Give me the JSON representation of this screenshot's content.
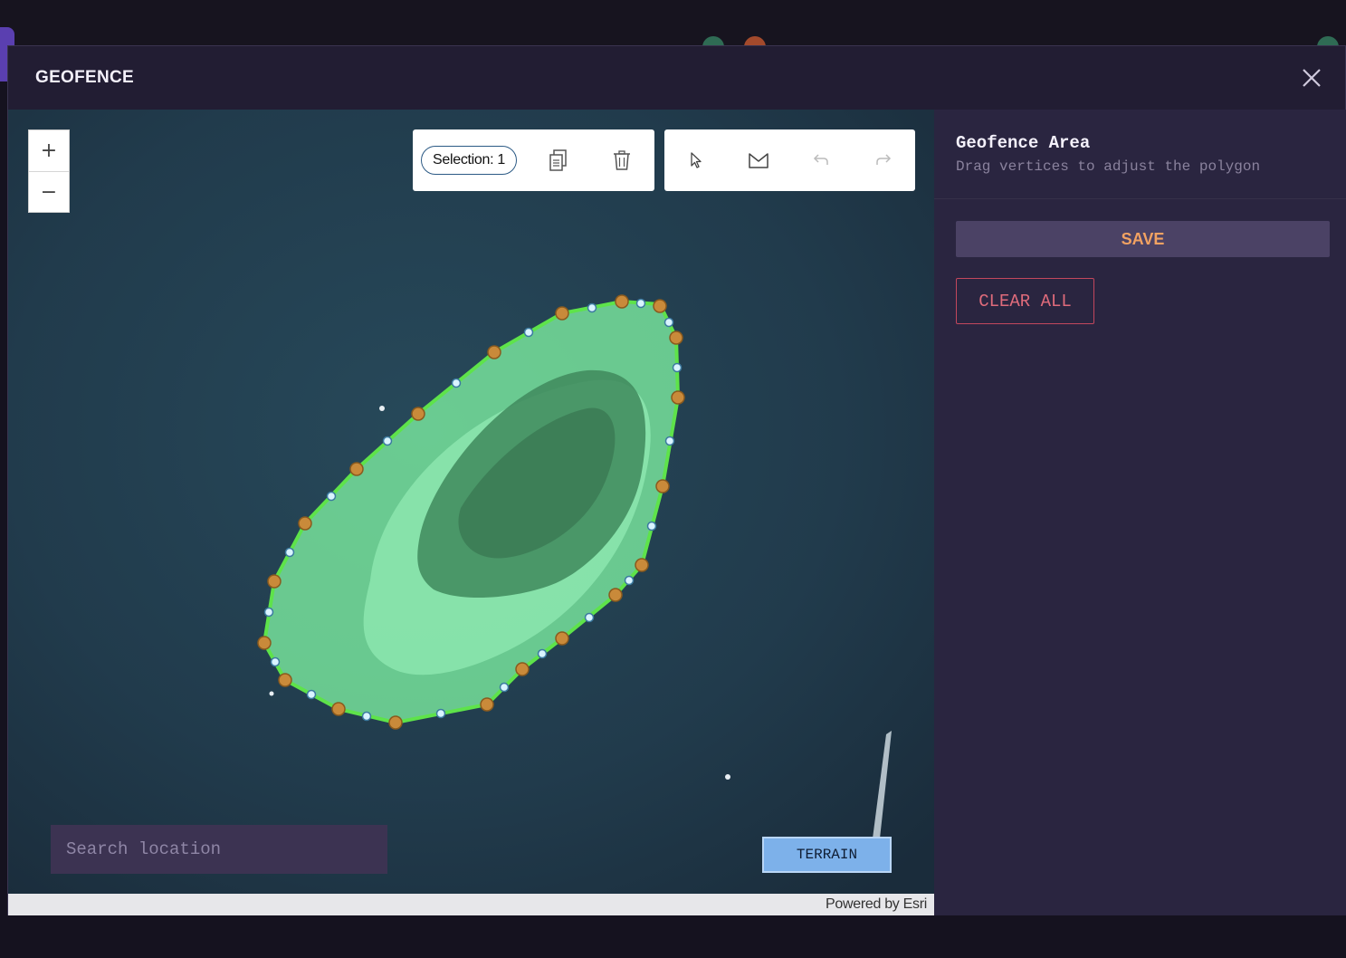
{
  "modal": {
    "title": "GEOFENCE"
  },
  "map": {
    "zoom_in_label": "+",
    "zoom_out_label": "−",
    "selection_label": "Selection: 1",
    "search_placeholder": "Search location",
    "terrain_label": "TERRAIN",
    "attribution": "Powered by Esri",
    "geofence_fill_color": "#7ef0a2",
    "geofence_stroke_color": "#5ee34a",
    "vertex_color": "#c98a3a",
    "midpoint_color": "#d9f4ff"
  },
  "panel": {
    "title": "Geofence Area",
    "subtitle": "Drag vertices to adjust the polygon",
    "save_label": "SAVE",
    "clear_label": "CLEAR ALL",
    "save_text_color": "#f2a262",
    "clear_color": "#df6b7b"
  }
}
